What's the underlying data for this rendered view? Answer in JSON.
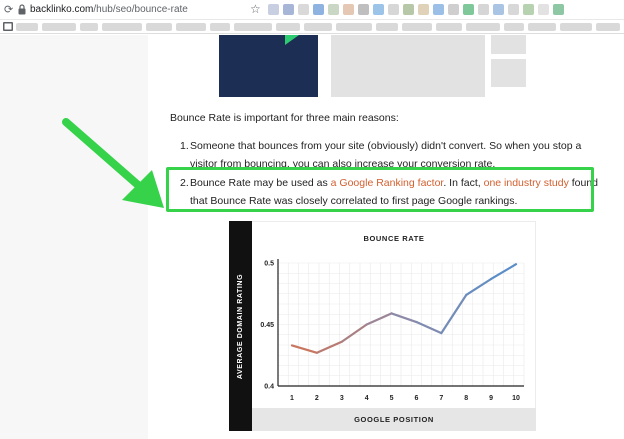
{
  "browser": {
    "url_domain": "backlinko.com",
    "url_path": "/hub/seo/bounce-rate",
    "nav_back_icon": "arrow-left-icon",
    "nav_refresh_icon": "refresh-icon",
    "lock_icon": "lock-icon",
    "star_icon": "star-icon",
    "extension_colors": [
      "#c8cfe0",
      "#a7b6d6",
      "#d9d9d9",
      "#8fb3e0",
      "#c9d7c4",
      "#e5c8b3",
      "#bfbfbf",
      "#9cc3e8",
      "#d7d7d7",
      "#b7c8a8",
      "#e0d2b8",
      "#9bbfe6",
      "#cfcfcf",
      "#7fc89a",
      "#d6d6d6",
      "#aac4e4",
      "#d8d8d8",
      "#b6d2b0",
      "#e2e2e2",
      "#8ec7a4"
    ]
  },
  "article": {
    "lead": "Bounce Rate is important for three main reasons:",
    "item1_num": "1.",
    "item1_line1": "Someone that bounces from your site (obviously) didn't convert. So when you stop a",
    "item1_line2": "visitor from bouncing, you can also increase your conversion rate.",
    "item2_num": "2.",
    "item2_text_a": "Bounce Rate may be used as ",
    "item2_link1": "a Google Ranking factor",
    "item2_text_b": ". In fact, ",
    "item2_link2": "one industry study",
    "item2_text_c": " found",
    "item2_line2": "that Bounce Rate was closely correlated to first page Google rankings.",
    "link_color": "#d35f2f",
    "highlight_color": "#35d24a"
  },
  "chart_data": {
    "type": "line",
    "title": "BOUNCE RATE",
    "xlabel": "GOOGLE POSITION",
    "ylabel": "AVERAGE DOMAIN RATING",
    "x": [
      1,
      2,
      3,
      4,
      5,
      6,
      7,
      8,
      9,
      10
    ],
    "y": [
      0.433,
      0.427,
      0.436,
      0.45,
      0.459,
      0.452,
      0.443,
      0.474,
      0.487,
      0.499
    ],
    "xlim": [
      1,
      10
    ],
    "ylim": [
      0.4,
      0.5
    ],
    "yticks": [
      "0.4",
      "0.45",
      "0.5"
    ],
    "xticks": [
      "1",
      "2",
      "3",
      "4",
      "5",
      "6",
      "7",
      "8",
      "9",
      "10"
    ],
    "grid": true,
    "segment_colors": [
      "#c8765f",
      "#8c8aa8",
      "#5b8ec8"
    ]
  }
}
